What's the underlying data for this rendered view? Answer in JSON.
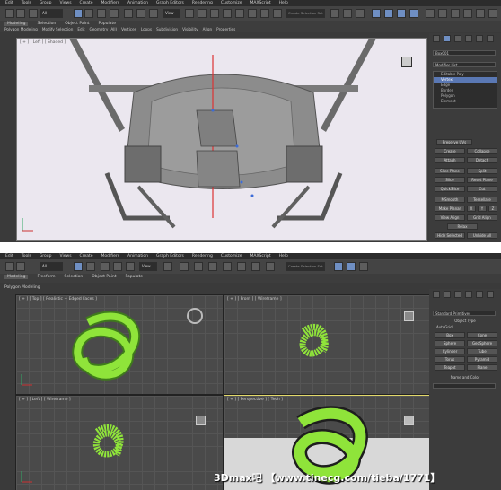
{
  "menu": [
    "Edit",
    "Tools",
    "Group",
    "Views",
    "Create",
    "Modifiers",
    "Animation",
    "Graph Editors",
    "Rendering",
    "Customize",
    "MAXScript",
    "Help"
  ],
  "ribbon_tabs_a": [
    "Modeling",
    "Selection",
    "Object Paint",
    "Populate"
  ],
  "ribbon_sub_a": [
    "Polygon Modeling",
    "Modify Selection",
    "Edit",
    "Geometry (All)",
    "Vertices",
    "Loops",
    "Subdivision",
    "Visibility",
    "Align",
    "Properties"
  ],
  "ribbon_tabs_b": [
    "Modeling",
    "Freeform",
    "Selection",
    "Object Paint",
    "Populate"
  ],
  "ribbon_sub_b": [
    "Polygon Modeling"
  ],
  "selection_set": "Create Selection Set",
  "all_filter": "All",
  "view_dropdown": "View",
  "viewport_a_label": "[ + ] [ Left ] [ Shaded ]",
  "panel_a": {
    "object_name": "Box001",
    "modifier_list": "Modifier List",
    "stack": [
      "Editable Poly",
      "Vertex",
      "Edge",
      "Border",
      "Polygon",
      "Element"
    ],
    "selected_index": 1,
    "buttons": [
      "Preserve UVs",
      "Create",
      "Collapse",
      "Attach",
      "Detach",
      "Slice Plane",
      "Split",
      "Slice",
      "Reset Plane",
      "QuickSlice",
      "Cut",
      "MSmooth",
      "Tessellate",
      "Make Planar",
      "X",
      "Y",
      "Z",
      "View Align",
      "Grid Align",
      "Relax",
      "Hide Selected",
      "Unhide All"
    ]
  },
  "viewports_b": [
    {
      "label": "[ + ] [ Top ] [ Realistic + Edged Faces ]"
    },
    {
      "label": "[ + ] [ Front ] [ Wireframe ]"
    },
    {
      "label": "[ + ] [ Left ] [ Wireframe ]"
    },
    {
      "label": "[ + ] [ Perspective ] [ Tech ]"
    }
  ],
  "panel_b": {
    "category": "Standard Primitives",
    "object_type_title": "Object Type",
    "autogrid": "AutoGrid",
    "primitives": [
      "Box",
      "Cone",
      "Sphere",
      "GeoSphere",
      "Cylinder",
      "Tube",
      "Torus",
      "Pyramid",
      "Teapot",
      "Plane"
    ],
    "name_color_title": "Name and Color"
  },
  "watermark": "3Dmax吧 【www.tinecg.com/tieba/1771】",
  "colors": {
    "knot_green": "#8fe43a",
    "knot_dark": "#3f7a1c",
    "selection_blue": "#5a78b4",
    "viewport_bg_a": "#ebe7ef"
  }
}
